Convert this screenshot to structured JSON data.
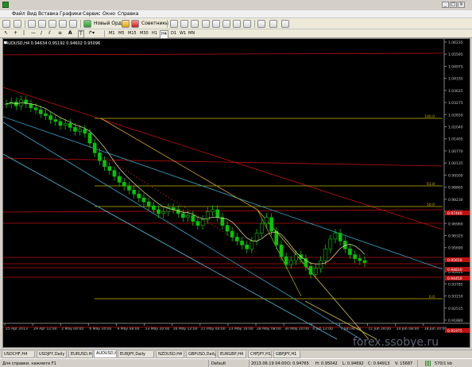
{
  "menu": [
    "Файл",
    "Вид",
    "Вставка",
    "Графики",
    "Сервис",
    "Окно",
    "Справка"
  ],
  "toolbar": {
    "new_order_label": "Новый Ордер",
    "advisors_label": "Советники",
    "timeframes": [
      "M1",
      "M5",
      "M15",
      "M30",
      "H1",
      "H4",
      "D1",
      "W1",
      "MN"
    ]
  },
  "chart_header": "AUDUSD,H4  0.94634 0.95192 0.94602 0.95096",
  "price_labels": [
    "1.06235",
    "1.05595",
    "1.04975",
    "1.04335",
    "1.03625",
    "1.03275",
    "1.02650",
    "1.02040",
    "1.01405",
    "1.00770",
    "1.00135",
    "0.99500",
    "0.98865",
    "0.98230",
    "0.97595",
    "0.96960",
    "0.96325",
    "0.95690",
    "0.95055",
    "0.94420",
    "0.93785",
    "0.93150",
    "0.92515",
    "0.91880"
  ],
  "fib_labels": [
    "100.0",
    "61.8",
    "50.0",
    "0.0"
  ],
  "highlighted_prices": [
    "0.97440",
    "0.95650",
    "0.94810",
    "0.94450",
    "0.91975"
  ],
  "time_labels": [
    "25 Apr 2013",
    "29 Apr 12:00",
    "2 May 04:00",
    "6 May 16:00",
    "9 May 08:00",
    "13 May 20:00",
    "16 May 12:00",
    "21 May 04:00",
    "23 May 16:00",
    "28 May 08:00",
    "30 May 20:00",
    "4 Jun 12:00",
    "7 Jun 04:00",
    "11 Jun 16:00",
    "14 Jun 08:00",
    "18 Jun 20:00"
  ],
  "tabs": [
    "USDCHF,H4",
    "USDJPY,Daily",
    "EURUSD,H4",
    "AUDUSD,H4",
    "EURJPY,Daily",
    "NZDUSD,H4",
    "GBPUSD,Daily",
    "EURGBP,H4",
    "CHFJPY,H1",
    "GBPJPY,H1"
  ],
  "active_tab_index": 3,
  "status": {
    "help": "Для справки, нажмите F1",
    "profile": "Default",
    "datetime": "2013.06.19 04:00",
    "open": "O: 0.94765",
    "high": "H: 0.95042",
    "low": "L: 0.94692",
    "close": "C: 0.94913",
    "volume": "V: 15687",
    "traffic": "570/1 kb"
  },
  "watermark": "forex.ssobye.ru",
  "colors": {
    "background": "#000000",
    "candle": "#00c800",
    "fib_line": "#c8b400",
    "red_line": "#c01010",
    "blue_line": "#3aa6c8"
  },
  "chart_data": {
    "type": "line",
    "symbol": "AUDUSD",
    "timeframe": "H4",
    "ylim": [
      0.9188,
      1.06235
    ],
    "close_values": [
      1.03,
      1.031,
      1.029,
      1.032,
      1.03,
      1.028,
      1.027,
      1.025,
      1.024,
      1.022,
      1.021,
      1.019,
      1.02,
      1.018,
      1.016,
      1.017,
      1.015,
      1.01,
      1.005,
      1.001,
      0.998,
      0.996,
      0.993,
      0.99,
      0.988,
      0.986,
      0.984,
      0.982,
      0.98,
      0.978,
      0.976,
      0.974,
      0.975,
      0.977,
      0.976,
      0.974,
      0.972,
      0.973,
      0.97,
      0.968,
      0.971,
      0.975,
      0.976,
      0.972,
      0.968,
      0.965,
      0.962,
      0.96,
      0.958,
      0.956,
      0.96,
      0.964,
      0.969,
      0.972,
      0.965,
      0.958,
      0.952,
      0.948,
      0.95,
      0.953,
      0.951,
      0.947,
      0.943,
      0.946,
      0.95,
      0.956,
      0.961,
      0.964,
      0.96,
      0.956,
      0.953,
      0.951,
      0.95,
      0.949
    ],
    "grid": false,
    "legend": "none"
  }
}
